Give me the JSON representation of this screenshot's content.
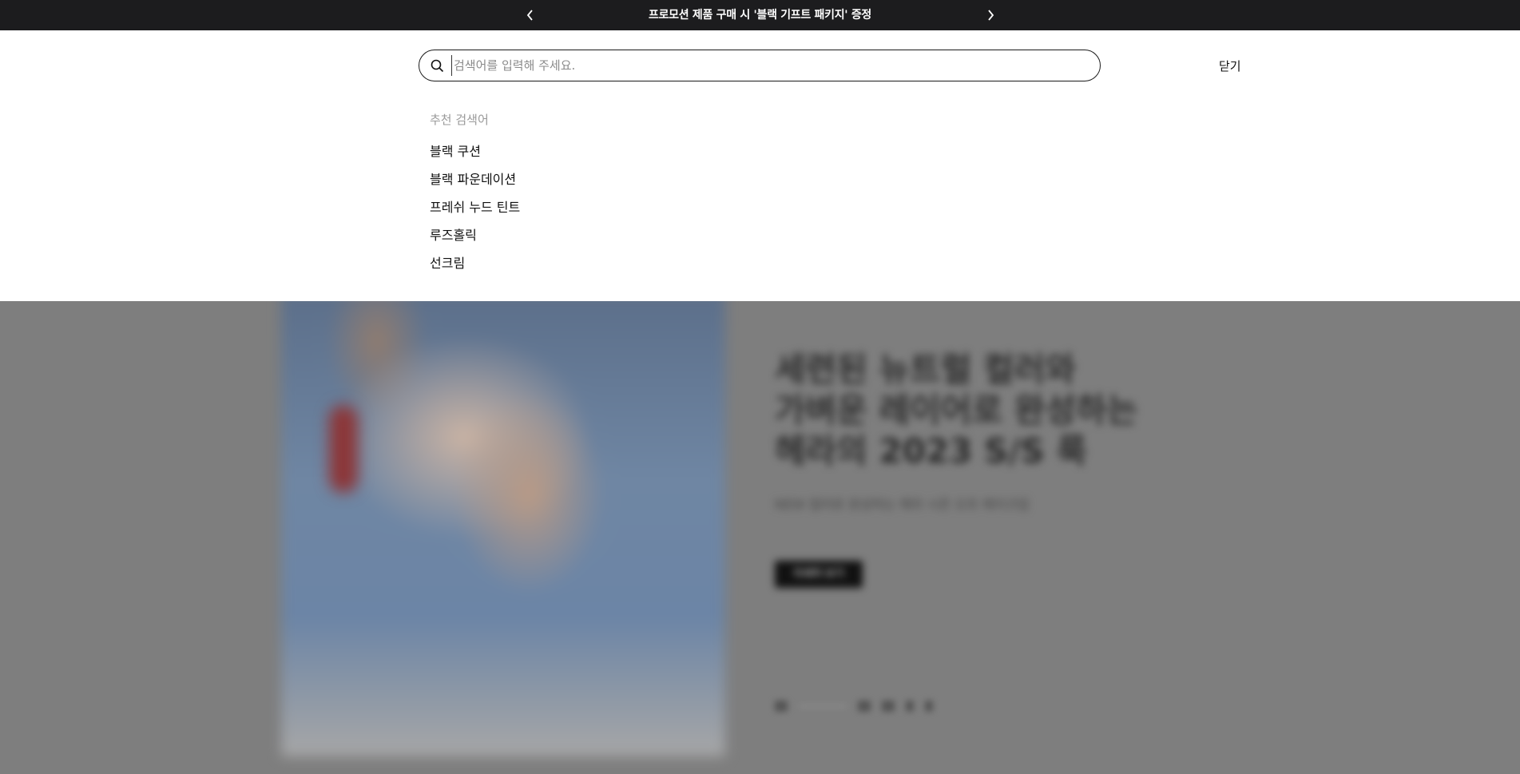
{
  "promo": {
    "text": "프로모션 제품 구매 시 '블랙 기프트 패키지' 증정",
    "prev_icon": "chevron-left-icon",
    "next_icon": "chevron-right-icon"
  },
  "search": {
    "placeholder": "검색어를 입력해 주세요.",
    "value": "",
    "icon": "search-icon",
    "close_label": "닫기"
  },
  "suggestions": {
    "title": "추천 검색어",
    "items": [
      "블랙 쿠션",
      "블랙 파운데이션",
      "프레쉬 누드 틴트",
      "루즈홀릭",
      "선크림"
    ]
  },
  "hero": {
    "title_lines": [
      "세련된 뉴트럴 컬러와",
      "가벼운 레이어로 완성하는",
      "헤라의 2023 S/S 룩"
    ],
    "subtitle": "NEW 컬러로 완성하는 헤라 시즌 오프 메이크업",
    "button_label": "자세히 보기"
  },
  "colors": {
    "promo_bg": "#1c1c1e",
    "overlay": "#7e7e7e",
    "text": "#111111",
    "muted": "#9a9a9a"
  }
}
